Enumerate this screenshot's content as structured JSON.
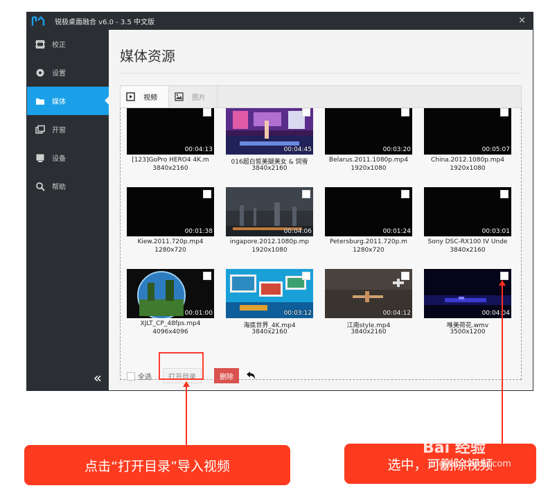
{
  "window": {
    "title": "锐极桌面融合 v6.0 - 3.5 中文版",
    "close_label": "×"
  },
  "sidebar": {
    "items": [
      {
        "label": "校正",
        "icon": "calibrate-icon"
      },
      {
        "label": "设置",
        "icon": "gear-icon"
      },
      {
        "label": "媒体",
        "icon": "folder-icon",
        "active": true
      },
      {
        "label": "开窗",
        "icon": "window-icon"
      },
      {
        "label": "设备",
        "icon": "device-icon"
      },
      {
        "label": "帮助",
        "icon": "search-icon"
      }
    ],
    "collapse_label": "«"
  },
  "main": {
    "title": "媒体资源",
    "tabs": [
      {
        "label": "视频",
        "icon": "play-icon",
        "active": true
      },
      {
        "label": "图片",
        "icon": "image-icon",
        "active": false
      }
    ],
    "media": [
      {
        "name": "[123]GoPro HERO4 4K.m",
        "resolution": "3840x2160",
        "duration": "00:04:13",
        "thumb": "dark"
      },
      {
        "name": "016超白皙美腿美女 & 饲雪",
        "resolution": "3840x2160",
        "duration": "00:04:45",
        "thumb": "stage"
      },
      {
        "name": "Belarus.2011.1080p.mp4",
        "resolution": "1920x1080",
        "duration": "00:03:20",
        "thumb": "dark"
      },
      {
        "name": "China.2012.1080p.mp4",
        "resolution": "1920x1080",
        "duration": "00:05:07",
        "thumb": "dark"
      },
      {
        "name": "Kiew.2011.720p.mp4",
        "resolution": "1280x720",
        "duration": "00:01:38",
        "thumb": "dark"
      },
      {
        "name": "ingapore.2012.1080p.mp",
        "resolution": "1920x1080",
        "duration": "00:04:06",
        "thumb": "city"
      },
      {
        "name": "Petersburg.2011.720p.m",
        "resolution": "1280x720",
        "duration": "00:01:24",
        "thumb": "dark"
      },
      {
        "name": "Sony DSC-RX100 IV Unde",
        "resolution": "3840x2160",
        "duration": "00:03:01",
        "thumb": "dark"
      },
      {
        "name": "XJLT_CP_48fps.mp4",
        "resolution": "4096x4096",
        "duration": "00:01:00",
        "thumb": "sphere"
      },
      {
        "name": "海底世界_4K.mp4",
        "resolution": "3840x2160",
        "duration": "00:03:12",
        "thumb": "ocean"
      },
      {
        "name": "江南style.mp4",
        "resolution": "3840x2160",
        "duration": "00:04:12",
        "thumb": "plane"
      },
      {
        "name": "唯美荷花.wmv",
        "resolution": "3500x1200",
        "duration": "00:04:04",
        "thumb": "night"
      }
    ],
    "footer": {
      "select_all": "全选",
      "open_dir": "打开目录",
      "delete": "删除"
    }
  },
  "annotations": {
    "left_callout": "点击“打开目录”导入视频",
    "right_callout": "选中，可删除视频",
    "watermark_brand": "Bai 经验",
    "watermark_url": "jingyan.baidu.com"
  },
  "colors": {
    "sidebar_bg": "#2b2e33",
    "accent": "#1aa0e8",
    "delete_btn": "#d9534f",
    "callout": "#ff3b1f"
  }
}
